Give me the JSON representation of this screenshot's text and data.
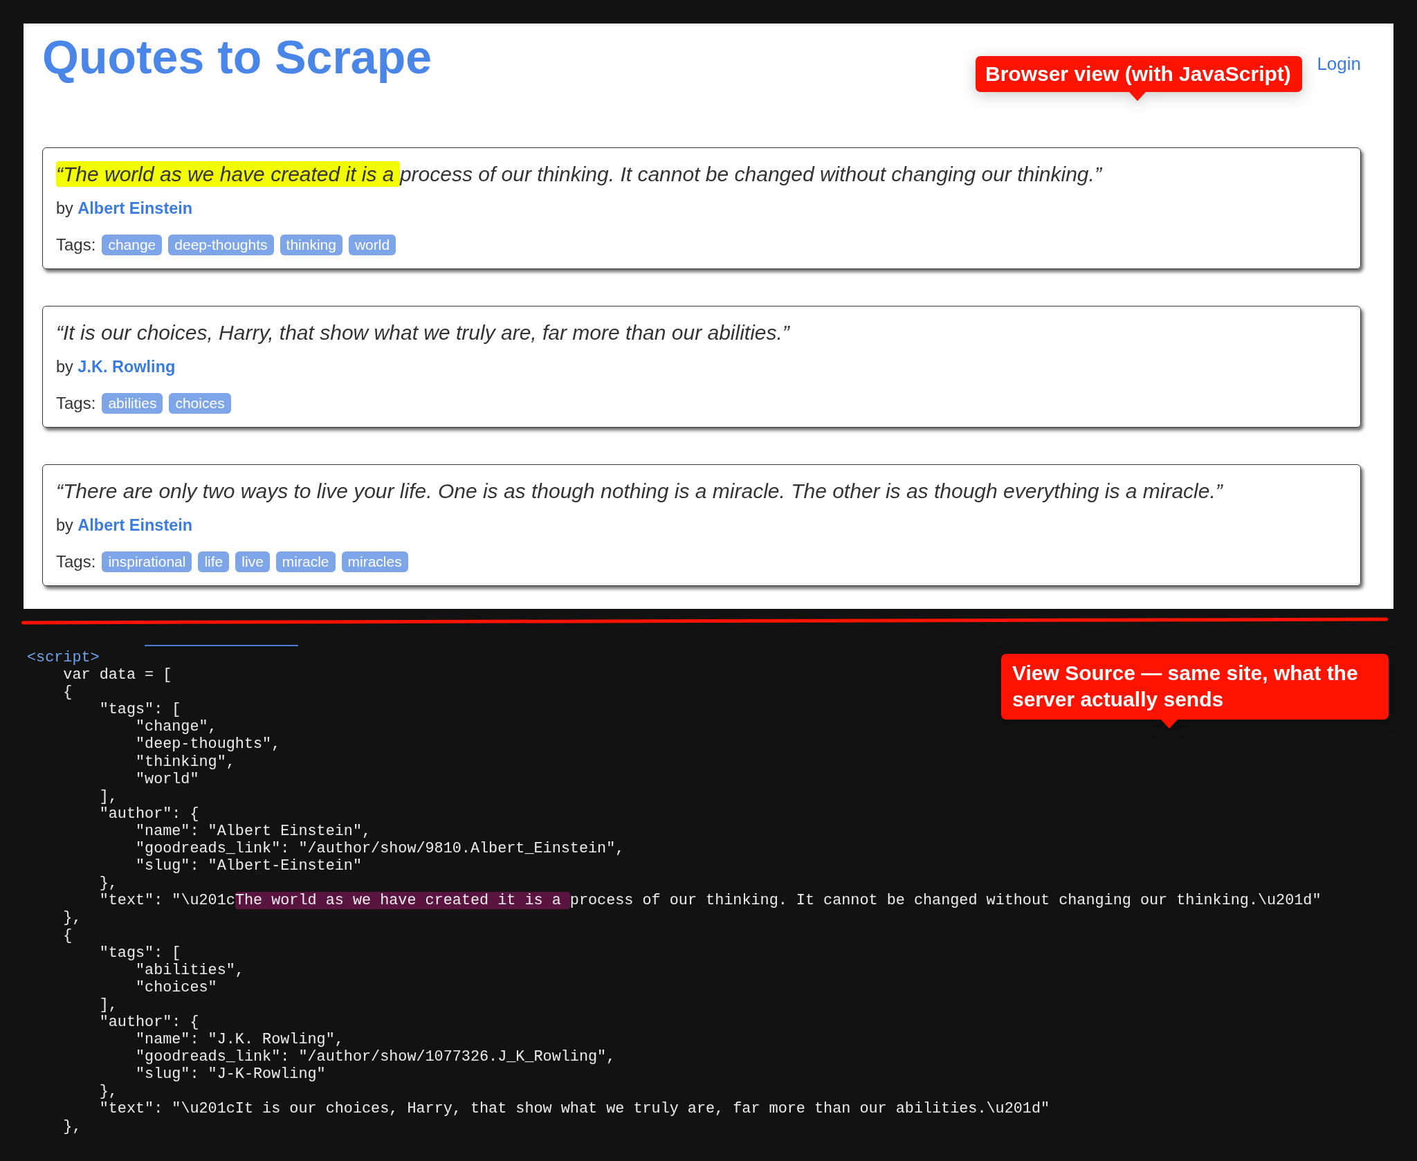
{
  "browser_view": {
    "title": "Quotes to Scrape",
    "login_link": "Login",
    "callout": "Browser view (with JavaScript)",
    "quotes": [
      {
        "segments": [
          {
            "text": "“The world as we have created it is a ",
            "highlighted": true
          },
          {
            "text": "process of our thinking. It cannot be changed without changing our thinking.”",
            "highlighted": false
          }
        ],
        "by": "by",
        "author": "Albert Einstein",
        "tags_label": "Tags:",
        "tags": [
          "change",
          "deep-thoughts",
          "thinking",
          "world"
        ]
      },
      {
        "segments": [
          {
            "text": "“It is our choices, Harry, that show what we truly are, far more than our abilities.”",
            "highlighted": false
          }
        ],
        "by": "by",
        "author": "J.K. Rowling",
        "tags_label": "Tags:",
        "tags": [
          "abilities",
          "choices"
        ]
      },
      {
        "segments": [
          {
            "text": "“There are only two ways to live your life. One is as though nothing is a miracle. The other is as though everything is a miracle.”",
            "highlighted": false
          }
        ],
        "by": "by",
        "author": "Albert Einstein",
        "tags_label": "Tags:",
        "tags": [
          "inspirational",
          "life",
          "live",
          "miracle",
          "miracles"
        ]
      }
    ]
  },
  "view_source": {
    "callout": "View Source — same site, what the server actually sends",
    "lines": [
      {
        "kind": "tag",
        "text": "<script>"
      },
      {
        "kind": "code",
        "text": "    var data = ["
      },
      {
        "kind": "code",
        "text": "    {"
      },
      {
        "kind": "code",
        "text": "        \"tags\": ["
      },
      {
        "kind": "code",
        "text": "            \"change\","
      },
      {
        "kind": "code",
        "text": "            \"deep-thoughts\","
      },
      {
        "kind": "code",
        "text": "            \"thinking\","
      },
      {
        "kind": "code",
        "text": "            \"world\""
      },
      {
        "kind": "code",
        "text": "        ],"
      },
      {
        "kind": "code",
        "text": "        \"author\": {"
      },
      {
        "kind": "code",
        "text": "            \"name\": \"Albert Einstein\","
      },
      {
        "kind": "code",
        "text": "            \"goodreads_link\": \"/author/show/9810.Albert_Einstein\","
      },
      {
        "kind": "code",
        "text": "            \"slug\": \"Albert-Einstein\""
      },
      {
        "kind": "code",
        "text": "        },"
      },
      {
        "kind": "code",
        "segments": [
          {
            "text": "        \"text\": \"\\u201c",
            "highlighted": false
          },
          {
            "text": "The world as we have created it is a ",
            "highlighted": true
          },
          {
            "text": "process of our thinking. It cannot be changed without changing our thinking.\\u201d\"",
            "highlighted": false
          }
        ]
      },
      {
        "kind": "code",
        "text": "    },"
      },
      {
        "kind": "code",
        "text": "    {"
      },
      {
        "kind": "code",
        "text": "        \"tags\": ["
      },
      {
        "kind": "code",
        "text": "            \"abilities\","
      },
      {
        "kind": "code",
        "text": "            \"choices\""
      },
      {
        "kind": "code",
        "text": "        ],"
      },
      {
        "kind": "code",
        "text": "        \"author\": {"
      },
      {
        "kind": "code",
        "text": "            \"name\": \"J.K. Rowling\","
      },
      {
        "kind": "code",
        "text": "            \"goodreads_link\": \"/author/show/1077326.J_K_Rowling\","
      },
      {
        "kind": "code",
        "text": "            \"slug\": \"J-K-Rowling\""
      },
      {
        "kind": "code",
        "text": "        },"
      },
      {
        "kind": "code",
        "text": "        \"text\": \"\\u201cIt is our choices, Harry, that show what we truly are, far more than our abilities.\\u201d\""
      },
      {
        "kind": "code",
        "text": "    },"
      }
    ]
  }
}
